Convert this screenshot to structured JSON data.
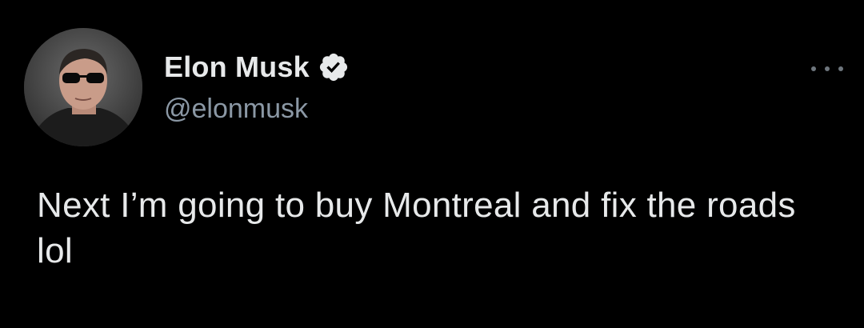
{
  "tweet": {
    "author": {
      "display_name": "Elon Musk",
      "handle": "@elonmusk",
      "verified_icon": "verified-badge-icon",
      "avatar": "profile-photo"
    },
    "text": "Next I’m going to buy Montreal and fix the roads lol",
    "more_icon": "ellipsis-icon"
  },
  "colors": {
    "background": "#000000",
    "name": "#e7e9ea",
    "handle": "#8b98a5",
    "text": "#e7e9ea",
    "verified": "#e7e9ea"
  }
}
